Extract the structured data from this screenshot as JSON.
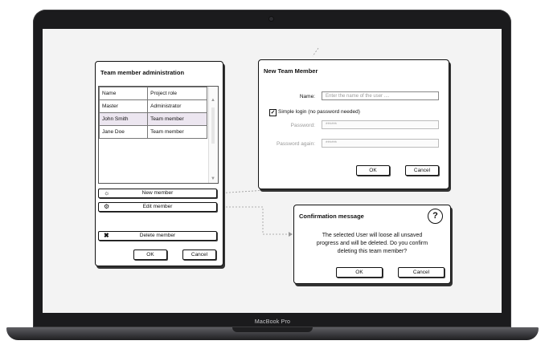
{
  "device": {
    "brand": "MacBook Pro"
  },
  "admin_window": {
    "title": "Team member administration",
    "columns": [
      "Name",
      "Project role"
    ],
    "rows": [
      {
        "name": "Master",
        "role": "Administrator"
      },
      {
        "name": "John Smith",
        "role": "Team member",
        "selected": true
      },
      {
        "name": "Jane Doe",
        "role": "Team member"
      }
    ],
    "new_label": "New member",
    "edit_label": "Edit member",
    "delete_label": "Delete member",
    "ok_label": "OK",
    "cancel_label": "Cancel"
  },
  "new_member_window": {
    "title": "New Team Member",
    "name_label": "Name:",
    "name_placeholder": "Enter the name of the user ....",
    "simple_login_label": "Simple login (no password needed)",
    "simple_login_checked": true,
    "password_label": "Password:",
    "password_value": "******",
    "password_again_label": "Password again:",
    "password_again_value": "******",
    "ok_label": "OK",
    "cancel_label": "Cancel"
  },
  "confirm_window": {
    "title": "Confirmation message",
    "message_line1": "The selected User will loose all unsaved",
    "message_line2": "progress and will be deleted. Do you confirm",
    "message_line3": "deleting this team member?",
    "help_icon": "?",
    "ok_label": "OK",
    "cancel_label": "Cancel"
  },
  "icons": {
    "new": "sun-icon",
    "edit": "gear-icon",
    "delete": "x-icon",
    "help": "question-circle-icon",
    "check": "checkmark-icon"
  },
  "colors": {
    "selected_row": "#ece6f0",
    "laptop_body": "#1b1b1d"
  }
}
